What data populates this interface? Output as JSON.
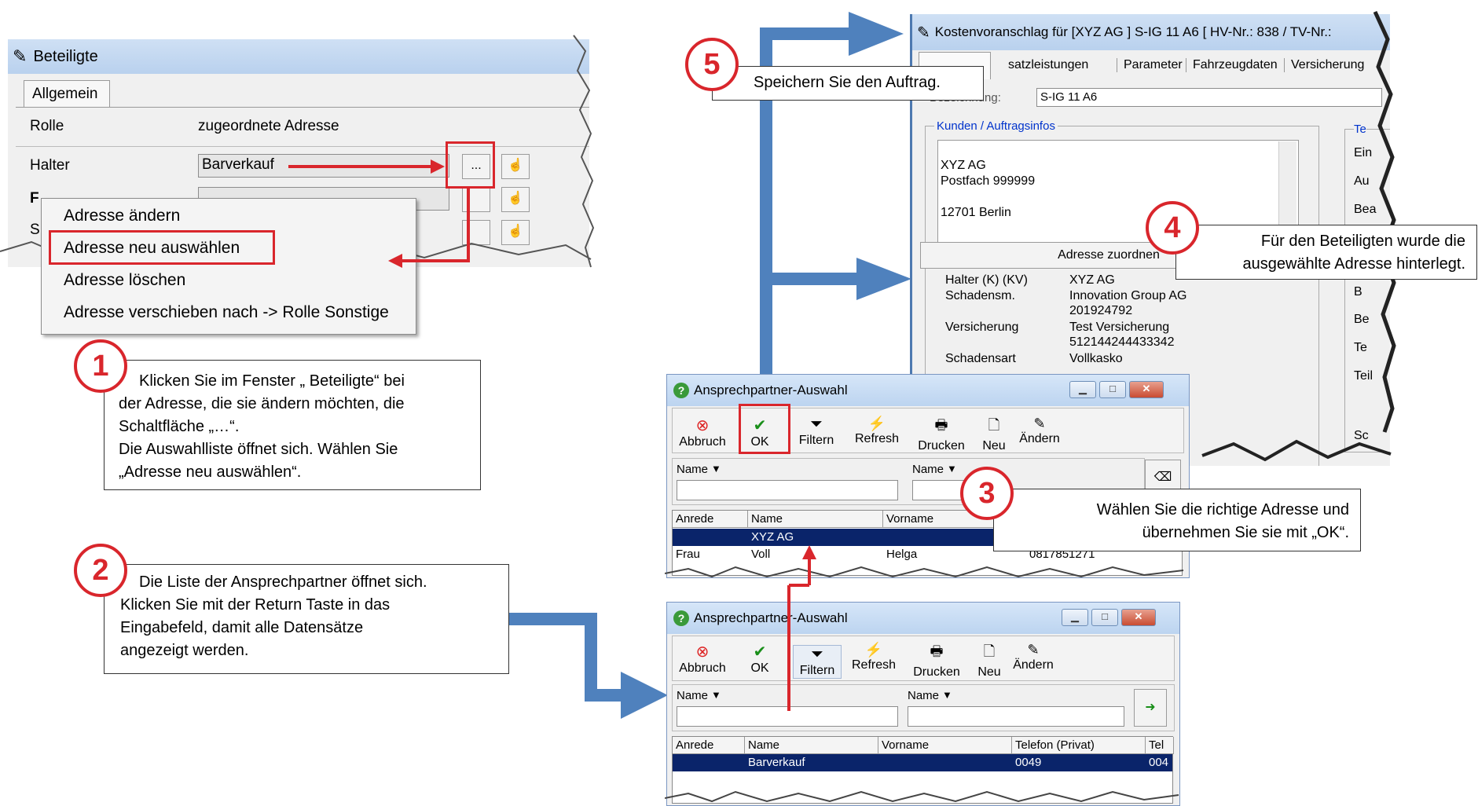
{
  "beteiligte": {
    "title": "Beteiligte",
    "tab": "Allgemein",
    "col_rolle": "Rolle",
    "col_adresse": "zugeordnete Adresse",
    "row_halter_label": "Halter",
    "row_halter_value": "Barverkauf",
    "row2_label": "F",
    "row3_label": "S",
    "dots_button": "..."
  },
  "context_menu": {
    "items": [
      "Adresse ändern",
      "Adresse neu auswählen",
      "Adresse löschen",
      "Adresse verschieben nach -> Rolle Sonstige"
    ]
  },
  "callouts": {
    "step1": {
      "number": "1",
      "lines": [
        "Klicken Sie im Fenster „ Beteiligte“ bei",
        "der Adresse, die sie ändern möchten, die",
        "Schaltfläche „…“.",
        "Die Auswahlliste öffnet sich. Wählen Sie",
        "„Adresse neu auswählen“."
      ]
    },
    "step2": {
      "number": "2",
      "lines": [
        "Die Liste der Ansprechpartner öffnet sich.",
        "Klicken Sie mit der Return Taste in das",
        "Eingabefeld, damit alle Datensätze",
        "angezeigt werden."
      ]
    },
    "step3": {
      "number": "3",
      "lines": [
        "Wählen Sie die richtige Adresse und",
        "übernehmen Sie sie mit „OK“."
      ]
    },
    "step4": {
      "number": "4",
      "lines": [
        "Für den Beteiligten wurde die",
        "ausgewählte Adresse hinterlegt."
      ]
    },
    "step5": {
      "number": "5",
      "lines": [
        "Speichern Sie den Auftrag."
      ]
    }
  },
  "kostenvoranschlag": {
    "title": "Kostenvoranschlag für [XYZ AG  ] S-IG 11 A6 [ HV-Nr.: 838 / TV-Nr.:",
    "tabs": [
      "satzleistungen",
      "Parameter",
      "Fahrzeugdaten",
      "Versicherung"
    ],
    "bezeichnung_label": "Bezeichnung:",
    "bezeichnung_value": "S-IG 11 A6",
    "group_label": "Kunden / Auftragsinfos",
    "address_lines": [
      "XYZ AG",
      "Postfach 999999",
      "",
      "12701 Berlin"
    ],
    "assign_button": "Adresse zuordnen",
    "info_rows": [
      {
        "label": "Halter (K) (KV)",
        "value": "XYZ AG"
      },
      {
        "label": "Schadensm.",
        "value": "Innovation Group AG"
      },
      {
        "label": "",
        "value": "201924792"
      },
      {
        "label": "Versicherung",
        "value": "Test Versicherung"
      },
      {
        "label": "",
        "value": "512144244433342"
      },
      {
        "label": "Schadensart",
        "value": "Vollkasko"
      }
    ],
    "right_fragments": [
      "Te",
      "Ein",
      "Au",
      "Bea",
      "B",
      "Be",
      "Te",
      "Teil",
      "Sc"
    ]
  },
  "ansprechpartner_top": {
    "title": "Ansprechpartner-Auswahl",
    "toolbar": [
      "Abbruch",
      "OK",
      "Filtern",
      "Refresh",
      "Drucken",
      "Neu",
      "Ändern"
    ],
    "filter_label_1": "Name",
    "filter_label_2": "Name",
    "columns": [
      "Anrede",
      "Name",
      "Vorname",
      ""
    ],
    "rows": [
      {
        "anrede": "",
        "name": "XYZ AG",
        "vorname": "",
        "tel": ""
      },
      {
        "anrede": "Frau",
        "name": "Voll",
        "vorname": "Helga",
        "tel": "0817851271"
      }
    ]
  },
  "ansprechpartner_bottom": {
    "title": "Ansprechpartner-Auswahl",
    "toolbar": [
      "Abbruch",
      "OK",
      "Filtern",
      "Refresh",
      "Drucken",
      "Neu",
      "Ändern"
    ],
    "filter_label_1": "Name",
    "filter_label_2": "Name",
    "columns": [
      "Anrede",
      "Name",
      "Vorname",
      "Telefon (Privat)",
      "Tel"
    ],
    "rows": [
      {
        "anrede": "",
        "name": "Barverkauf",
        "vorname": "",
        "tel": "0049",
        "tel2": "004"
      }
    ]
  },
  "colors": {
    "accent_red": "#d9262c",
    "arrow_blue": "#4f81bd",
    "selection": "#0a246a"
  }
}
